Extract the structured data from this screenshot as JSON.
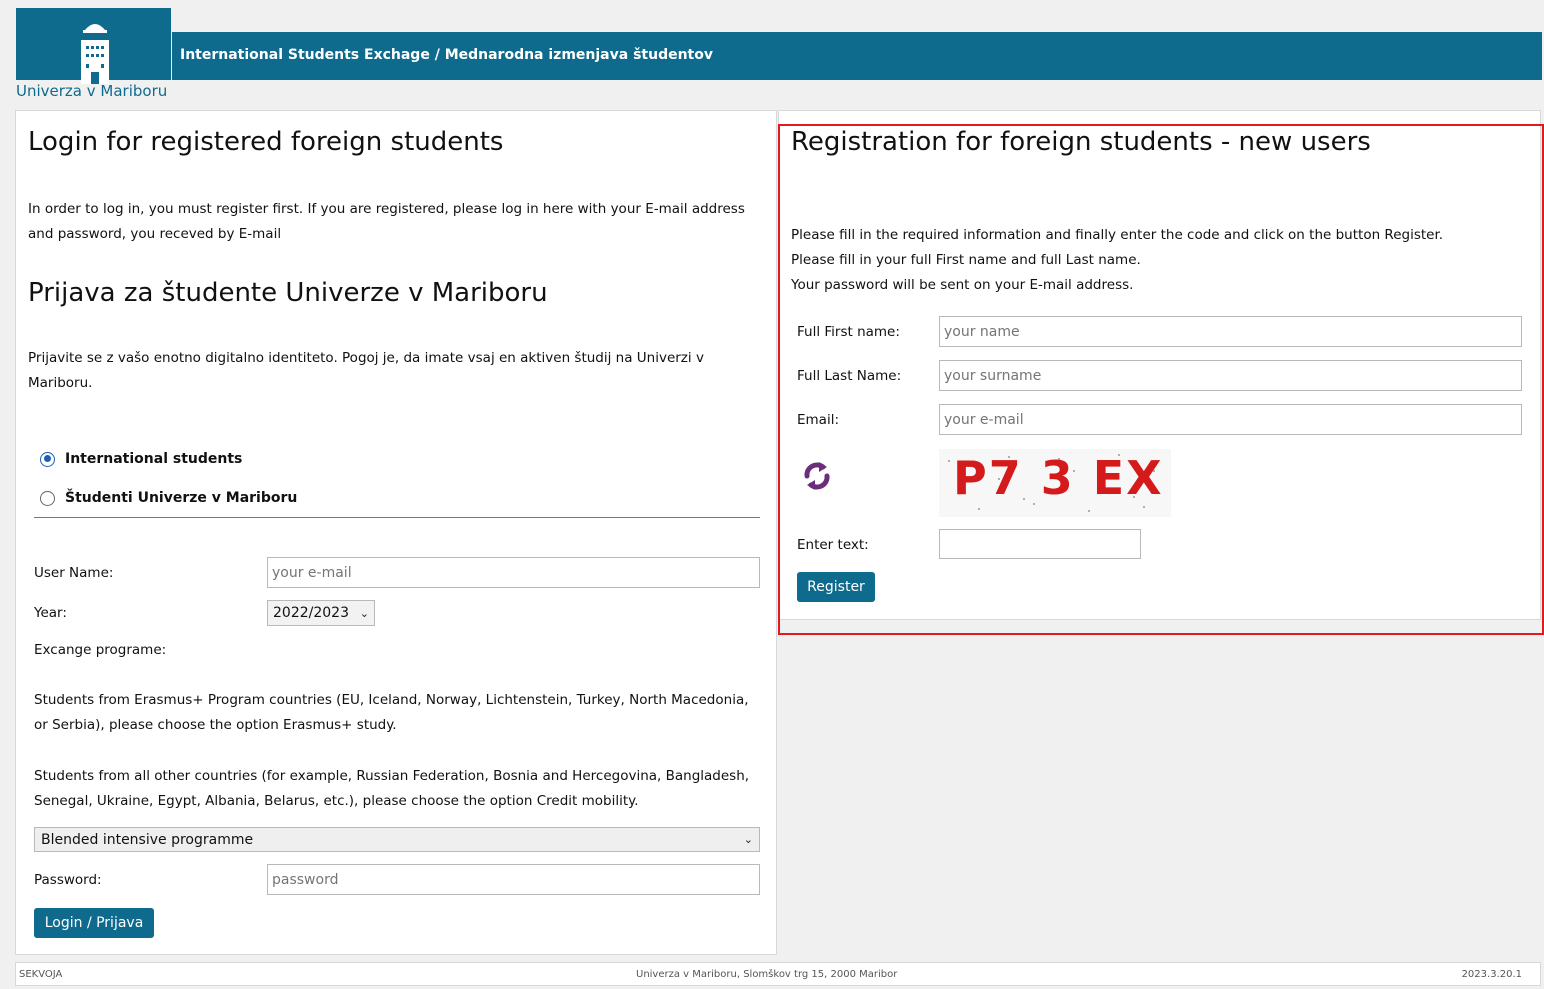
{
  "header": {
    "title": "International Students Exchage / Mednarodna izmenjava študentov",
    "university": "Univerza v Mariboru",
    "brand_color": "#0f6b8e"
  },
  "login": {
    "heading": "Login for registered foreign students",
    "intro_line1": "In order to log in, you must register first. If you are registered, please log in here with your E-mail address",
    "intro_line2": "and password, you receved by E-mail",
    "um_heading": "Prijava za študente Univerze v Mariboru",
    "um_line1": "Prijavite se z vašo enotno digitalno identiteto. Pogoj je, da imate vsaj en aktiven študij na Univerzi v",
    "um_line2": "Mariboru.",
    "radio_international": "International students",
    "radio_um": "Študenti Univerze v Mariboru",
    "username_label": "User Name:",
    "username_placeholder": "your e-mail",
    "year_label": "Year:",
    "year_value": "2022/2023",
    "program_label": "Excange programe:",
    "erasmus_line1": "Students from Erasmus+ Program countries (EU, Iceland, Norway, Lichtenstein, Turkey, North Macedonia,",
    "erasmus_line2": "or Serbia), please choose the option Erasmus+ study.",
    "other_line1": "Students from all other countries (for example, Russian Federation, Bosnia and Hercegovina, Bangladesh,",
    "other_line2": "Senegal, Ukraine, Egypt, Albania, Belarus, etc.), please choose the option Credit mobility.",
    "program_value": "Blended intensive programme",
    "password_label": "Password:",
    "password_placeholder": "password",
    "login_button": "Login / Prijava"
  },
  "registration": {
    "heading": "Registration for foreign students - new users",
    "info_line1": "Please fill in the required information and finally enter the code and click on the button Register.",
    "info_line2": "Please fill in your full First name and full Last name.",
    "info_line3": "Your password will be sent on your E-mail address.",
    "first_label": "Full First name:",
    "first_placeholder": "your name",
    "last_label": "Full Last Name:",
    "last_placeholder": "your surname",
    "email_label": "Email:",
    "email_placeholder": "your e-mail",
    "captcha_text": "P7 3 EX",
    "enter_text_label": "Enter text:",
    "register_button": "Register"
  },
  "footer": {
    "left": "SEKVOJA",
    "center": "Univerza v Mariboru, Slomškov trg 15, 2000 Maribor",
    "right": "2023.3.20.1"
  }
}
